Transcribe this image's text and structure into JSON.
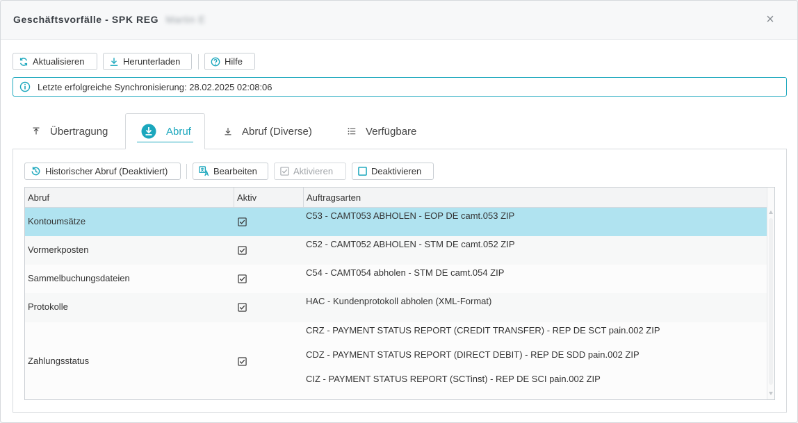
{
  "dialog": {
    "title": "Geschäftsvorfälle - SPK REG",
    "title_name": "Martin E",
    "close_label": "×"
  },
  "toolbar": {
    "refresh_label": "Aktualisieren",
    "download_label": "Herunterladen",
    "help_label": "Hilfe"
  },
  "info": {
    "sync_text": "Letzte erfolgreiche Synchronisierung: 28.02.2025 02:08:06"
  },
  "tabs": [
    {
      "label": "Übertragung",
      "icon": "upload-icon"
    },
    {
      "label": "Abruf",
      "icon": "download-circle-icon"
    },
    {
      "label": "Abruf (Diverse)",
      "icon": "download-icon"
    },
    {
      "label": "Verfügbare",
      "icon": "list-icon"
    }
  ],
  "subtoolbar": {
    "history_label": "Historischer Abruf (Deaktiviert)",
    "edit_label": "Bearbeiten",
    "activate_label": "Aktivieren",
    "deactivate_label": "Deaktivieren"
  },
  "table": {
    "columns": [
      "Abruf",
      "Aktiv",
      "Auftragsarten"
    ],
    "rows": [
      {
        "abruf": "Kontoumsätze",
        "aktiv": true,
        "auftragsarten": [
          "C53 - CAMT053 ABHOLEN - EOP DE camt.053 ZIP"
        ]
      },
      {
        "abruf": "Vormerkposten",
        "aktiv": true,
        "auftragsarten": [
          "C52 - CAMT052 ABHOLEN - STM DE camt.052 ZIP"
        ]
      },
      {
        "abruf": "Sammelbuchungsdateien",
        "aktiv": true,
        "auftragsarten": [
          "C54 - CAMT054 abholen - STM DE camt.054 ZIP"
        ]
      },
      {
        "abruf": "Protokolle",
        "aktiv": true,
        "auftragsarten": [
          "HAC - Kundenprotokoll abholen (XML-Format)"
        ]
      },
      {
        "abruf": "Zahlungsstatus",
        "aktiv": true,
        "auftragsarten": [
          "CRZ - PAYMENT STATUS REPORT (CREDIT TRANSFER) - REP DE SCT pain.002 ZIP",
          "CDZ - PAYMENT STATUS REPORT (DIRECT DEBIT) - REP DE SDD pain.002 ZIP",
          "CIZ - PAYMENT STATUS REPORT (SCTinst) - REP DE SCI pain.002 ZIP"
        ]
      }
    ]
  },
  "colors": {
    "accent": "#1ba7bd",
    "selected_row": "#b0e3f0"
  }
}
